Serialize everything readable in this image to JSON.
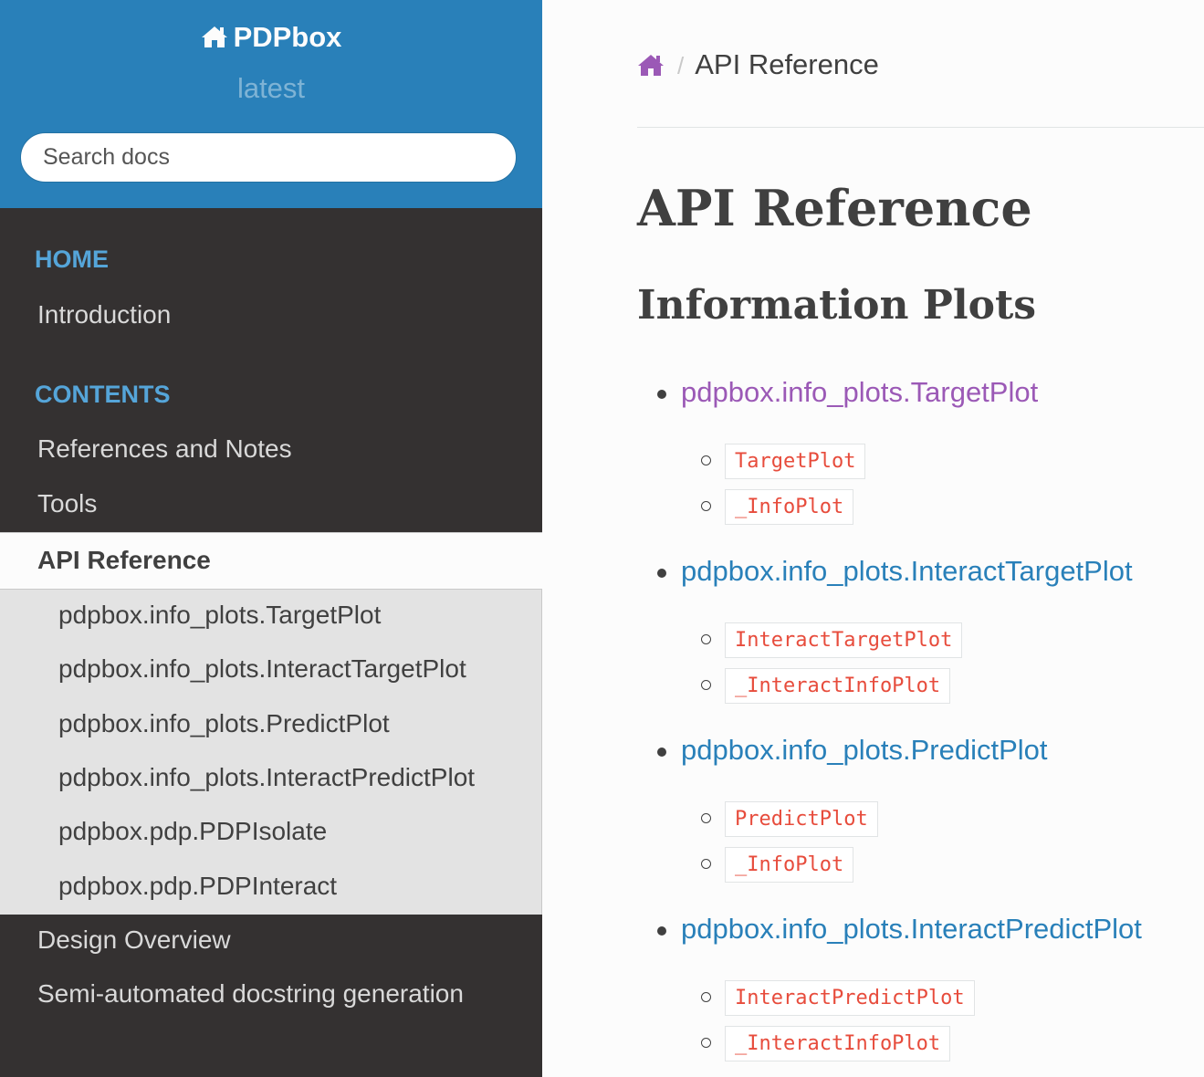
{
  "sidebar": {
    "brand": "PDPbox",
    "version": "latest",
    "search_placeholder": "Search docs",
    "captions": {
      "home": "HOME",
      "contents": "CONTENTS"
    },
    "home_items": [
      "Introduction"
    ],
    "contents_items": [
      "References and Notes",
      "Tools"
    ],
    "current": "API Reference",
    "sub_items": [
      "pdpbox.info_plots.TargetPlot",
      "pdpbox.info_plots.InteractTargetPlot",
      "pdpbox.info_plots.PredictPlot",
      "pdpbox.info_plots.InteractPredictPlot",
      "pdpbox.pdp.PDPIsolate",
      "pdpbox.pdp.PDPInteract"
    ],
    "after_items": [
      "Design Overview",
      "Semi-automated docstring generation"
    ]
  },
  "breadcrumb": {
    "separator": "/",
    "current": "API Reference"
  },
  "content": {
    "title": "API Reference",
    "section_title": "Information Plots",
    "modules": [
      {
        "name": "pdpbox.info_plots.TargetPlot",
        "classes": [
          "TargetPlot",
          "_InfoPlot"
        ]
      },
      {
        "name": "pdpbox.info_plots.InteractTargetPlot",
        "classes": [
          "InteractTargetPlot",
          "_InteractInfoPlot"
        ]
      },
      {
        "name": "pdpbox.info_plots.PredictPlot",
        "classes": [
          "PredictPlot",
          "_InfoPlot"
        ]
      },
      {
        "name": "pdpbox.info_plots.InteractPredictPlot",
        "classes": [
          "InteractPredictPlot",
          "_InteractInfoPlot"
        ]
      }
    ]
  },
  "colors": {
    "sidebar_head": "#2980b9",
    "sidebar_bg": "#343131",
    "caption": "#55a5d9",
    "link": "#2980b9",
    "visited_link": "#9b59b6",
    "code": "#e74c3c"
  },
  "icons": {
    "brand": "home-icon",
    "breadcrumb_home": "home-icon"
  }
}
